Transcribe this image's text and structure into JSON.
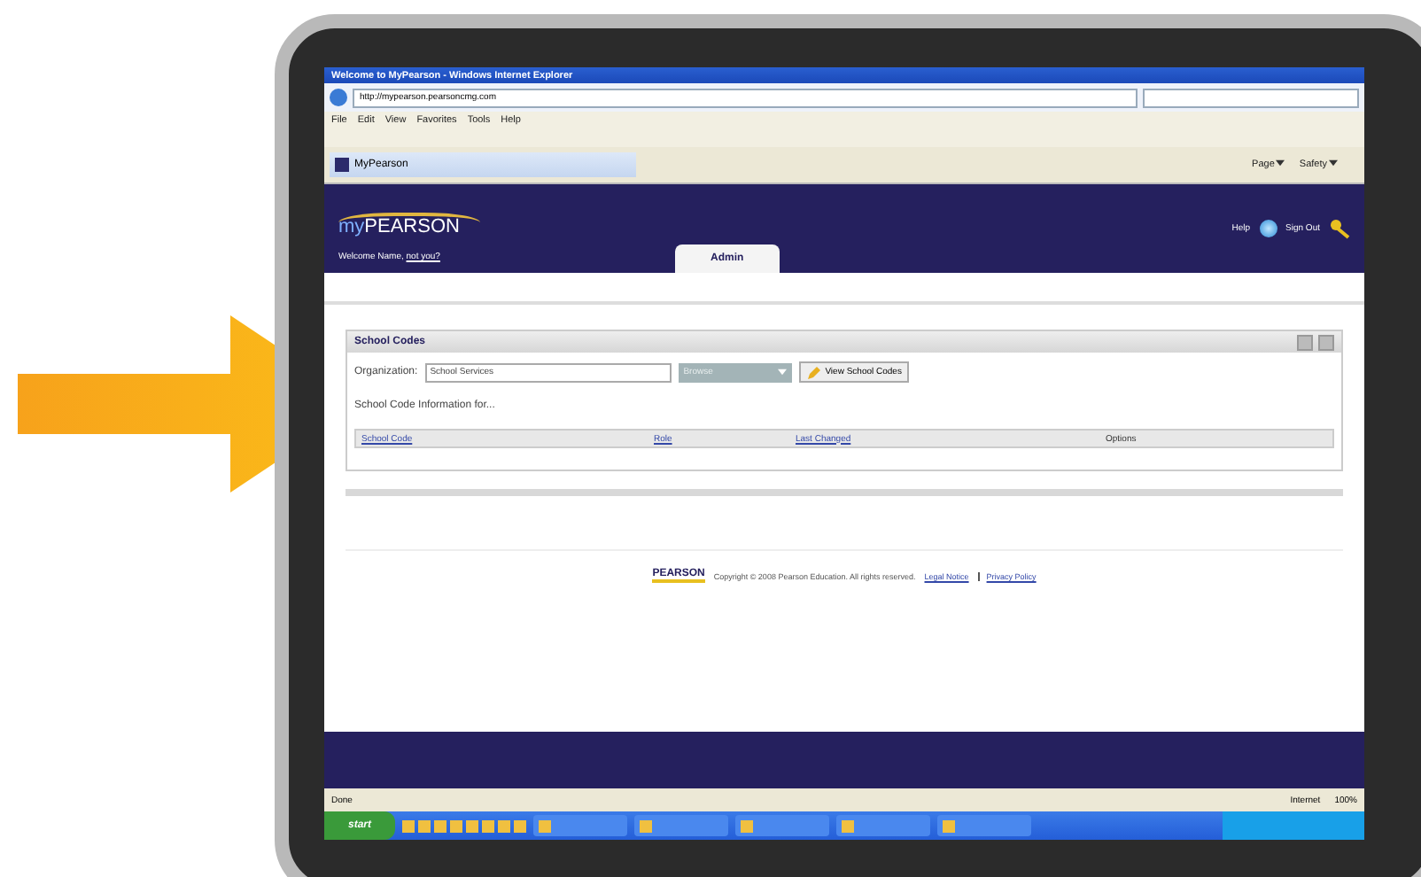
{
  "browser": {
    "title": "Welcome to MyPearson - Windows Internet Explorer",
    "address": "http://mypearson.pearsoncmg.com",
    "menu": [
      "File",
      "Edit",
      "View",
      "Favorites",
      "Tools",
      "Help"
    ],
    "tab": "MyPearson",
    "commands": [
      "Page",
      "Safety"
    ]
  },
  "header": {
    "logo_prefix": "my",
    "logo": "PEARSON",
    "welcome": "Welcome Name,",
    "not_you": "not you?",
    "tabs": [
      {
        "label": "Admin",
        "selected": true
      }
    ],
    "help": "Help",
    "sign_out": "Sign Out"
  },
  "panel": {
    "title": "School Codes",
    "org_label": "Organization:",
    "org_value": "School Services",
    "dropdown": "Browse",
    "button": "View School Codes",
    "info": "School Code Information for...",
    "columns": [
      "School Code",
      "Role",
      "Last Changed",
      "Options"
    ]
  },
  "footer": {
    "logo": "PEARSON",
    "copyright": "Copyright © 2008 Pearson Education. All rights reserved.",
    "links": [
      "Legal Notice",
      "Privacy Policy"
    ]
  },
  "status": {
    "left": "Done",
    "zone": "Internet",
    "zoom": "100%"
  },
  "taskbar": {
    "start": "start"
  }
}
